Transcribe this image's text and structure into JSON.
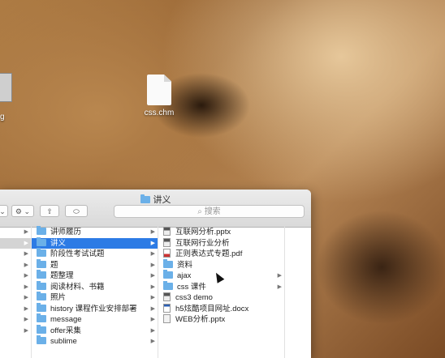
{
  "desktop": {
    "partial_icon_label": "g",
    "file_label": "css.chm"
  },
  "finder": {
    "title": "讲义",
    "search_placeholder": "搜索",
    "col1_rows": [
      "",
      "",
      "",
      "",
      "",
      "",
      "",
      "",
      "",
      ""
    ],
    "col2_rows": [
      {
        "label": "讲师履历",
        "arrow": true,
        "selected": false
      },
      {
        "label": "讲义",
        "arrow": true,
        "selected": true
      },
      {
        "label": "阶段性考试试题",
        "arrow": true,
        "selected": false
      },
      {
        "label": "题",
        "arrow": true,
        "selected": false
      },
      {
        "label": "题整理",
        "arrow": true,
        "selected": false
      },
      {
        "label": "阅读材料、书籍",
        "arrow": true,
        "selected": false
      },
      {
        "label": "照片",
        "arrow": true,
        "selected": false
      },
      {
        "label": "history 课程作业安排部署",
        "arrow": true,
        "selected": false
      },
      {
        "label": "message",
        "arrow": true,
        "selected": false
      },
      {
        "label": "offer采集",
        "arrow": true,
        "selected": false
      },
      {
        "label": "sublime",
        "arrow": true,
        "selected": false
      }
    ],
    "col3_rows": [
      {
        "label": "互联网分析.pptx",
        "icon": "dark",
        "arrow": false
      },
      {
        "label": "互联网行业分析",
        "icon": "dark",
        "arrow": false
      },
      {
        "label": "正则表达式专题.pdf",
        "icon": "pdf",
        "arrow": false
      },
      {
        "label": "资料",
        "icon": "folder",
        "arrow": false
      },
      {
        "label": "ajax",
        "icon": "folder",
        "arrow": true
      },
      {
        "label": "css 课件",
        "icon": "folder",
        "arrow": true
      },
      {
        "label": "css3 demo",
        "icon": "dark",
        "arrow": false
      },
      {
        "label": "h5炫酷项目网址.docx",
        "icon": "word",
        "arrow": false
      },
      {
        "label": "WEB分析.pptx",
        "icon": "doc",
        "arrow": false
      }
    ]
  }
}
